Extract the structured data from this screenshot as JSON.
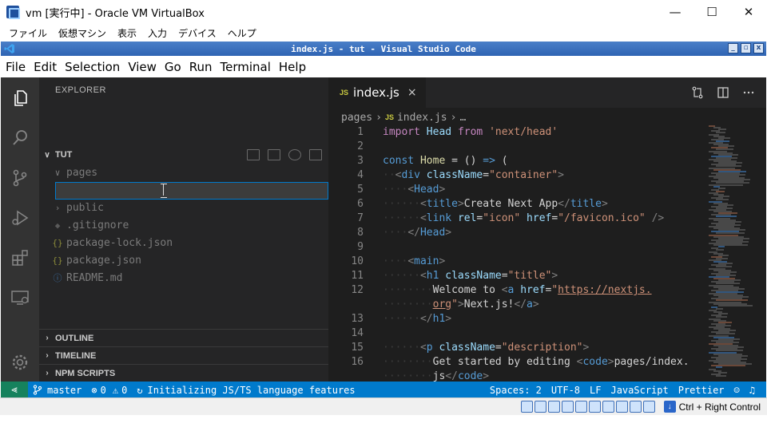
{
  "host": {
    "title": "vm [実行中] - Oracle VM VirtualBox",
    "menu": [
      "ファイル",
      "仮想マシン",
      "表示",
      "入力",
      "デバイス",
      "ヘルプ"
    ],
    "controls": {
      "minimize": "—",
      "maximize": "☐",
      "close": "✕"
    },
    "host_key": "Ctrl + Right Control"
  },
  "guest": {
    "title": "index.js - tut - Visual Studio Code",
    "controls": {
      "minimize": "_",
      "maximize": "▫",
      "close": "x"
    }
  },
  "vscode": {
    "menu": [
      "File",
      "Edit",
      "Selection",
      "View",
      "Go",
      "Run",
      "Terminal",
      "Help"
    ],
    "explorer": {
      "title": "EXPLORER",
      "root": "TUT",
      "tree": [
        {
          "label": "pages",
          "icon": "chevron-down-icon"
        },
        {
          "label": "public",
          "icon": "chevron-right-icon"
        },
        {
          "label": ".gitignore",
          "icon": "diamond-icon"
        },
        {
          "label": "package-lock.json",
          "icon": "braces-icon"
        },
        {
          "label": "package.json",
          "icon": "braces-icon"
        },
        {
          "label": "README.md",
          "icon": "info-icon"
        }
      ],
      "sections": [
        "OUTLINE",
        "TIMELINE",
        "NPM SCRIPTS"
      ]
    },
    "tab": {
      "badge": "JS",
      "label": "index.js",
      "close": "×"
    },
    "breadcrumb": {
      "folder": "pages",
      "badge": "JS",
      "file": "index.js",
      "more": "…"
    },
    "code": [
      {
        "n": "1",
        "tokens": [
          [
            "kw2",
            "import"
          ],
          [
            "txt",
            " "
          ],
          [
            "var",
            "Head"
          ],
          [
            "txt",
            " "
          ],
          [
            "kw2",
            "from"
          ],
          [
            "txt",
            " "
          ],
          [
            "str",
            "'next/head'"
          ]
        ]
      },
      {
        "n": "2",
        "tokens": []
      },
      {
        "n": "3",
        "tokens": [
          [
            "kw",
            "const"
          ],
          [
            "txt",
            " "
          ],
          [
            "fn",
            "Home"
          ],
          [
            "txt",
            " = () "
          ],
          [
            "kw",
            "=>"
          ],
          [
            "txt",
            " ("
          ]
        ]
      },
      {
        "n": "4",
        "tokens": [
          [
            "ws",
            "··"
          ],
          [
            "ptag",
            "<"
          ],
          [
            "tag",
            "div"
          ],
          [
            "txt",
            " "
          ],
          [
            "var",
            "className"
          ],
          [
            "txt",
            "="
          ],
          [
            "str",
            "\"container\""
          ],
          [
            "ptag",
            ">"
          ]
        ]
      },
      {
        "n": "5",
        "tokens": [
          [
            "ws",
            "····"
          ],
          [
            "ptag",
            "<"
          ],
          [
            "tag",
            "Head"
          ],
          [
            "ptag",
            ">"
          ]
        ]
      },
      {
        "n": "6",
        "tokens": [
          [
            "ws",
            "······"
          ],
          [
            "ptag",
            "<"
          ],
          [
            "tag",
            "title"
          ],
          [
            "ptag",
            ">"
          ],
          [
            "txt",
            "Create Next App"
          ],
          [
            "ptag",
            "</"
          ],
          [
            "tag",
            "title"
          ],
          [
            "ptag",
            ">"
          ]
        ]
      },
      {
        "n": "7",
        "tokens": [
          [
            "ws",
            "······"
          ],
          [
            "ptag",
            "<"
          ],
          [
            "tag",
            "link"
          ],
          [
            "txt",
            " "
          ],
          [
            "var",
            "rel"
          ],
          [
            "txt",
            "="
          ],
          [
            "str",
            "\"icon\""
          ],
          [
            "txt",
            " "
          ],
          [
            "var",
            "href"
          ],
          [
            "txt",
            "="
          ],
          [
            "str",
            "\"/favicon.ico\""
          ],
          [
            "txt",
            " "
          ],
          [
            "ptag",
            "/>"
          ]
        ]
      },
      {
        "n": "8",
        "tokens": [
          [
            "ws",
            "····"
          ],
          [
            "ptag",
            "</"
          ],
          [
            "tag",
            "Head"
          ],
          [
            "ptag",
            ">"
          ]
        ]
      },
      {
        "n": "9",
        "tokens": []
      },
      {
        "n": "10",
        "tokens": [
          [
            "ws",
            "····"
          ],
          [
            "ptag",
            "<"
          ],
          [
            "tag",
            "main"
          ],
          [
            "ptag",
            ">"
          ]
        ]
      },
      {
        "n": "11",
        "tokens": [
          [
            "ws",
            "······"
          ],
          [
            "ptag",
            "<"
          ],
          [
            "tag",
            "h1"
          ],
          [
            "txt",
            " "
          ],
          [
            "var",
            "className"
          ],
          [
            "txt",
            "="
          ],
          [
            "str",
            "\"title\""
          ],
          [
            "ptag",
            ">"
          ]
        ]
      },
      {
        "n": "12",
        "tokens": [
          [
            "ws",
            "········"
          ],
          [
            "txt",
            "Welcome to "
          ],
          [
            "ptag",
            "<"
          ],
          [
            "tag",
            "a"
          ],
          [
            "txt",
            " "
          ],
          [
            "var",
            "href"
          ],
          [
            "txt",
            "="
          ],
          [
            "str",
            "\""
          ],
          [
            "link",
            "https://nextjs."
          ]
        ]
      },
      {
        "n": "",
        "tokens": [
          [
            "ws",
            "········"
          ],
          [
            "link",
            "org"
          ],
          [
            "str",
            "\""
          ],
          [
            "ptag",
            ">"
          ],
          [
            "txt",
            "Next.js!"
          ],
          [
            "ptag",
            "</"
          ],
          [
            "tag",
            "a"
          ],
          [
            "ptag",
            ">"
          ]
        ]
      },
      {
        "n": "13",
        "tokens": [
          [
            "ws",
            "······"
          ],
          [
            "ptag",
            "</"
          ],
          [
            "tag",
            "h1"
          ],
          [
            "ptag",
            ">"
          ]
        ]
      },
      {
        "n": "14",
        "tokens": []
      },
      {
        "n": "15",
        "tokens": [
          [
            "ws",
            "······"
          ],
          [
            "ptag",
            "<"
          ],
          [
            "tag",
            "p"
          ],
          [
            "txt",
            " "
          ],
          [
            "var",
            "className"
          ],
          [
            "txt",
            "="
          ],
          [
            "str",
            "\"description\""
          ],
          [
            "ptag",
            ">"
          ]
        ]
      },
      {
        "n": "16",
        "tokens": [
          [
            "ws",
            "········"
          ],
          [
            "txt",
            "Get started by editing "
          ],
          [
            "ptag",
            "<"
          ],
          [
            "tag",
            "code"
          ],
          [
            "ptag",
            ">"
          ],
          [
            "txt",
            "pages/index."
          ]
        ]
      },
      {
        "n": "",
        "tokens": [
          [
            "ws",
            "········"
          ],
          [
            "txt",
            "js"
          ],
          [
            "ptag",
            "</"
          ],
          [
            "tag",
            "code"
          ],
          [
            "ptag",
            ">"
          ]
        ]
      }
    ],
    "status": {
      "remote": "⪡",
      "branch": "master",
      "errors": "0",
      "warnings": "0",
      "message": "Initializing JS/TS language features",
      "spaces": "Spaces: 2",
      "encoding": "UTF-8",
      "eol": "LF",
      "language": "JavaScript",
      "formatter": "Prettier"
    }
  }
}
